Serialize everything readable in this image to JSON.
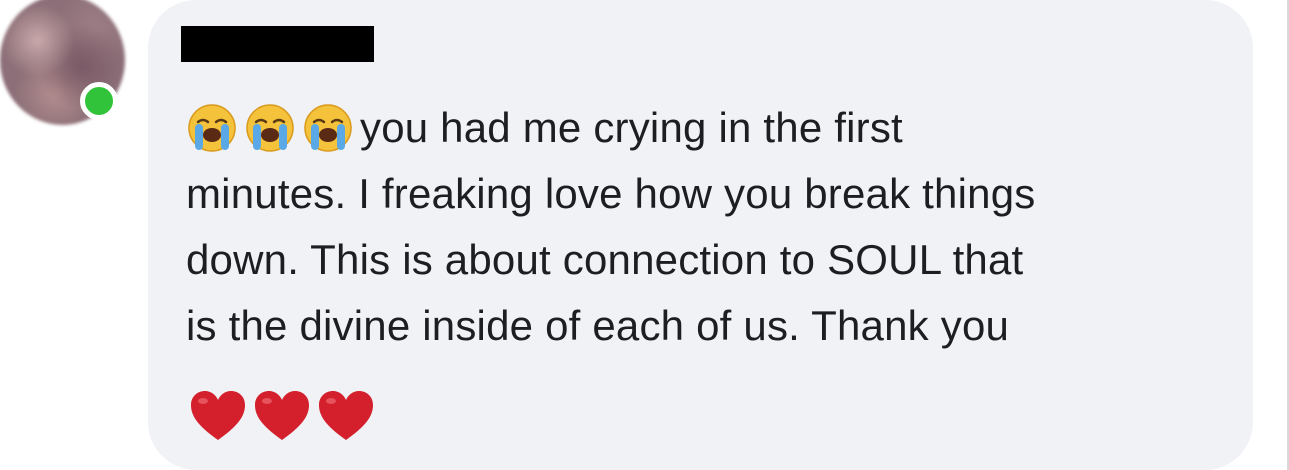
{
  "comment": {
    "author_name_redacted": true,
    "author_online": true,
    "emoji_prefix": [
      "loudly-crying-face",
      "loudly-crying-face",
      "loudly-crying-face"
    ],
    "lines": [
      "you had me crying in the first",
      "minutes.  I freaking love how you break things",
      "down.  This is about connection to SOUL that",
      "is the divine inside of each of us.  Thank you"
    ],
    "emoji_suffix": [
      "red-heart",
      "red-heart",
      "red-heart"
    ]
  },
  "colors": {
    "bubble": "#f0f2f5",
    "text": "#1c1e21",
    "presence": "#31c43a",
    "heart": "#d4202c",
    "emoji_face": "#f5c33b",
    "tears": "#5aa9e6"
  }
}
